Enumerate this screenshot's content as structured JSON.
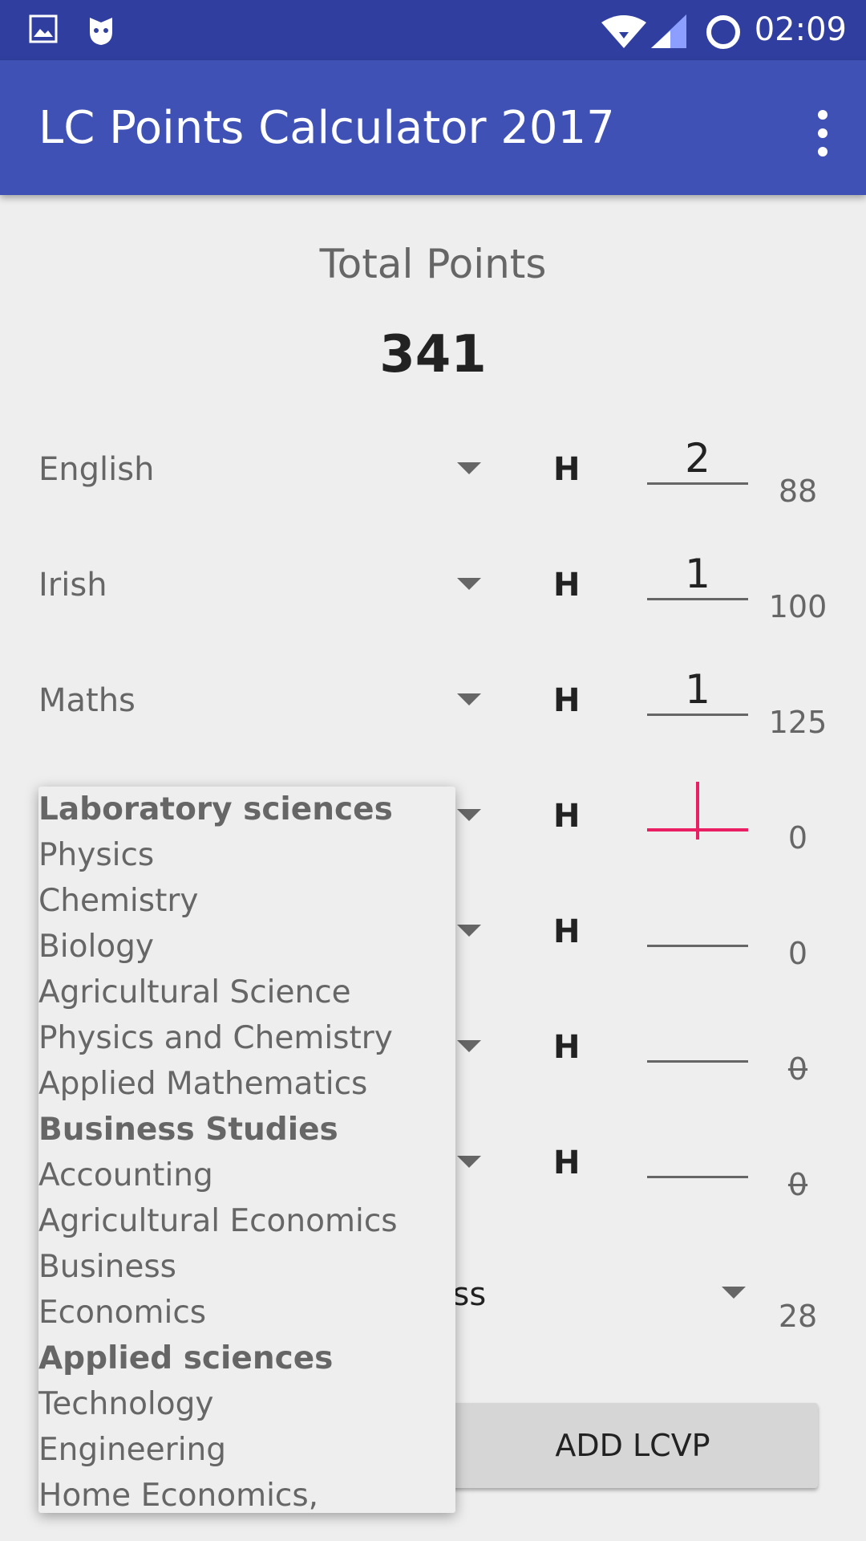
{
  "status_bar": {
    "time": "02:09",
    "icons": [
      "image-icon",
      "cat-icon",
      "wifi-icon",
      "signal-icon",
      "circle-icon"
    ]
  },
  "app_bar": {
    "title": "LC Points Calculator 2017",
    "menu_icon": "overflow-menu-icon"
  },
  "total": {
    "label": "Total Points",
    "value": "341"
  },
  "subjects": [
    {
      "name": "English",
      "level": "H",
      "grade": "2",
      "points": "88",
      "struck": false
    },
    {
      "name": "Irish",
      "level": "H",
      "grade": "1",
      "points": "100",
      "struck": false
    },
    {
      "name": "Maths",
      "level": "H",
      "grade": "1",
      "points": "125",
      "struck": false
    },
    {
      "name": "",
      "level": "H",
      "grade": "",
      "points": "0",
      "struck": false
    },
    {
      "name": "",
      "level": "H",
      "grade": "",
      "points": "0",
      "struck": false
    },
    {
      "name": "",
      "level": "H",
      "grade": "",
      "points": "0",
      "struck": true
    },
    {
      "name": "",
      "level": "H",
      "grade": "",
      "points": "0",
      "struck": true
    }
  ],
  "bonus": {
    "text": "ass",
    "points": "28"
  },
  "add_lcvp": "ADD LCVP",
  "dropdown": {
    "items": [
      {
        "label": "Laboratory sciences",
        "header": true
      },
      {
        "label": "Physics",
        "header": false
      },
      {
        "label": "Chemistry",
        "header": false
      },
      {
        "label": "Biology",
        "header": false
      },
      {
        "label": "Agricultural Science",
        "header": false
      },
      {
        "label": "Physics and Chemistry",
        "header": false
      },
      {
        "label": "Applied Mathematics",
        "header": false
      },
      {
        "label": "Business Studies",
        "header": true
      },
      {
        "label": "Accounting",
        "header": false
      },
      {
        "label": "Agricultural Economics",
        "header": false
      },
      {
        "label": "Business",
        "header": false
      },
      {
        "label": "Economics",
        "header": false
      },
      {
        "label": "Applied sciences",
        "header": true
      },
      {
        "label": "Technology",
        "header": false
      },
      {
        "label": "Engineering",
        "header": false
      },
      {
        "label": "Home Economics,",
        "header": false
      }
    ]
  }
}
